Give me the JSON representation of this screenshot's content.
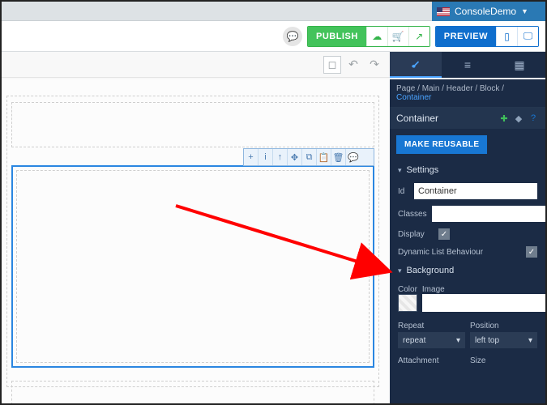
{
  "account": {
    "name": "ConsoleDemo"
  },
  "actions": {
    "publish": "PUBLISH",
    "preview": "PREVIEW"
  },
  "breadcrumb": {
    "parts": [
      "Page",
      "Main",
      "Header",
      "Block"
    ],
    "current": "Container"
  },
  "panel": {
    "title": "Container",
    "make_reusable": "MAKE REUSABLE",
    "sections": {
      "settings": "Settings",
      "background": "Background"
    },
    "fields": {
      "id_label": "Id",
      "id_value": "Container",
      "classes_label": "Classes",
      "classes_value": "",
      "display_label": "Display",
      "display_checked": true,
      "dynamic_label": "Dynamic List Behaviour",
      "dynamic_checked": true,
      "color_label": "Color",
      "image_label": "Image",
      "image_value": "",
      "repeat_label": "Repeat",
      "repeat_value": "repeat",
      "position_label": "Position",
      "position_value": "left top",
      "attachment_label": "Attachment",
      "size_label": "Size"
    }
  }
}
